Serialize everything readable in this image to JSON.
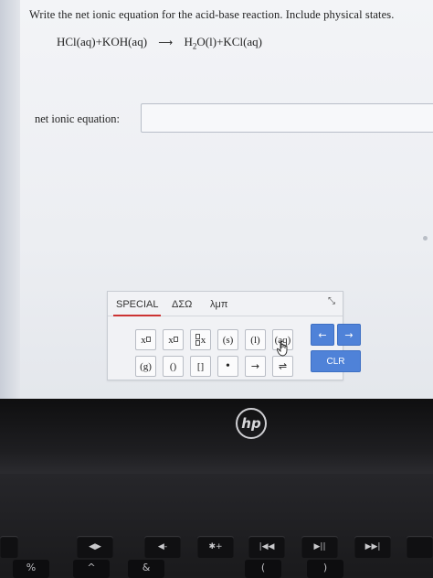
{
  "question": {
    "prompt": "Write the net ionic equation for the acid-base reaction. Include physical states.",
    "reactants": "HCl(aq)+KOH(aq)",
    "arrow": "⟶",
    "product_prefix": "H",
    "product_subscript": "2",
    "product_rest": "O(l)+KCl(aq)"
  },
  "answer": {
    "label": "net ionic equation:",
    "value": ""
  },
  "palette": {
    "tabs": [
      "SPECIAL",
      "ΔΣΩ",
      "λμπ"
    ],
    "close_label": "×",
    "keys_row1": [
      "x□",
      "x□",
      "□x",
      "(s)",
      "(l)",
      "(aq)"
    ],
    "keys_row2": [
      "(g)",
      "()",
      "[]",
      "•",
      "→",
      "⇌"
    ],
    "nav_left": "←",
    "nav_right": "→",
    "clear_label": "CLR",
    "accent_color": "#4f82d8"
  },
  "laptop": {
    "brand": "hp",
    "fkeys": [
      "◀◀",
      "◀▶",
      "✱",
      "✱+",
      "|◀◀",
      "▶||",
      "▶▶|"
    ],
    "numkeys": [
      "%",
      "^",
      "&",
      "(",
      ")"
    ]
  }
}
